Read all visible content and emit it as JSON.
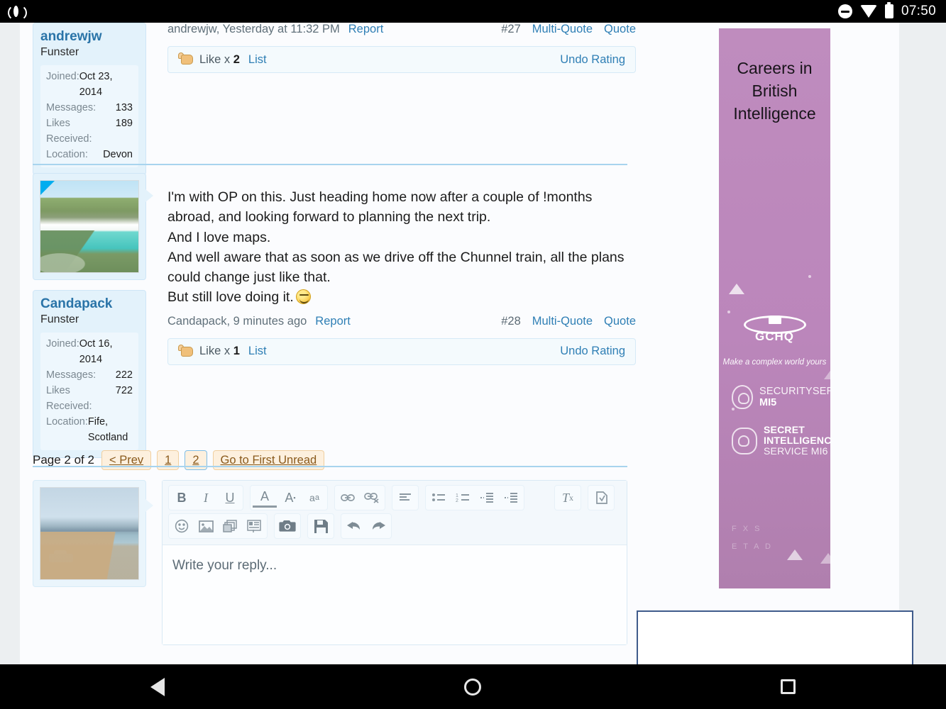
{
  "status_bar": {
    "time": "07:50",
    "icons": [
      "broadcast-icon",
      "do-not-disturb-icon",
      "wifi-icon",
      "battery-icon"
    ]
  },
  "posts": [
    {
      "user": {
        "name": "andrewjw",
        "title": "Funster",
        "stats": [
          {
            "key": "Joined:",
            "value": "Oct 23, 2014"
          },
          {
            "key": "Messages:",
            "value": "133"
          },
          {
            "key": "Likes Received:",
            "value": "189"
          },
          {
            "key": "Location:",
            "value": "Devon"
          }
        ]
      },
      "meta": {
        "byline": "andrewjw, Yesterday at 11:32 PM",
        "report": "Report",
        "number": "#27",
        "multi_quote": "Multi-Quote",
        "quote": "Quote"
      },
      "rating": {
        "label": "Like x",
        "count": "2",
        "list": "List",
        "undo": "Undo Rating"
      }
    },
    {
      "user": {
        "name": "Candapack",
        "title": "Funster",
        "stats": [
          {
            "key": "Joined:",
            "value": "Oct 16, 2014"
          },
          {
            "key": "Messages:",
            "value": "222"
          },
          {
            "key": "Likes Received:",
            "value": "722"
          },
          {
            "key": "Location:",
            "value": "Fife, Scotland"
          }
        ]
      },
      "body_lines": [
        "I'm with OP on this. Just heading home now after a couple of !months",
        "abroad, and looking forward to planning the next trip.",
        "And I love maps.",
        "And well aware that as soon as we drive off the Chunnel train, all the plans",
        "could change just like that.",
        "But still love doing it."
      ],
      "meta": {
        "byline": "Candapack, 9 minutes ago",
        "report": "Report",
        "number": "#28",
        "multi_quote": "Multi-Quote",
        "quote": "Quote"
      },
      "rating": {
        "label": "Like x",
        "count": "1",
        "list": "List",
        "undo": "Undo Rating"
      }
    }
  ],
  "pagination": {
    "label": "Page 2 of 2",
    "prev": "< Prev",
    "page1": "1",
    "page2": "2",
    "first_unread": "Go to First Unread"
  },
  "editor": {
    "placeholder": "Write your reply...",
    "toolbar_row1": [
      {
        "name": "bold-icon",
        "glyph": "B"
      },
      {
        "name": "italic-icon",
        "glyph": "I"
      },
      {
        "name": "underline-icon",
        "glyph": "U"
      },
      {
        "name": "text-color-icon",
        "glyph": "A"
      },
      {
        "name": "font-size-icon",
        "glyph": "A"
      },
      {
        "name": "font-family-icon",
        "glyph": "a"
      },
      {
        "name": "insert-link-icon",
        "glyph": "link"
      },
      {
        "name": "remove-link-icon",
        "glyph": "unlink"
      },
      {
        "name": "align-icon",
        "glyph": "align"
      },
      {
        "name": "bullet-list-icon",
        "glyph": "ul"
      },
      {
        "name": "numbered-list-icon",
        "glyph": "ol"
      },
      {
        "name": "indent-icon",
        "glyph": "indent"
      },
      {
        "name": "outdent-icon",
        "glyph": "outdent"
      },
      {
        "name": "remove-formatting-icon",
        "glyph": "Tx"
      },
      {
        "name": "draft-icon",
        "glyph": "draft"
      }
    ],
    "toolbar_row2": [
      {
        "name": "smilies-icon",
        "glyph": "smile"
      },
      {
        "name": "insert-image-icon",
        "glyph": "image"
      },
      {
        "name": "media-icon",
        "glyph": "media"
      },
      {
        "name": "insert-quote-icon",
        "glyph": "quote"
      },
      {
        "name": "camera-icon",
        "glyph": "camera"
      },
      {
        "name": "save-icon",
        "glyph": "save"
      },
      {
        "name": "undo-icon",
        "glyph": "undo"
      },
      {
        "name": "redo-icon",
        "glyph": "redo"
      }
    ]
  },
  "advertisement": {
    "headline_lines": [
      "Careers in",
      "British",
      "Intelligence"
    ],
    "gchq": "GCHQ",
    "tagline": "Make a complex world yours",
    "security_service": {
      "line1_bold": "SECURITY",
      "line1_light": "SERVICE",
      "line2": "MI5"
    },
    "secret_intelligence": {
      "line1": "SECRET",
      "line2": "INTELLIGENCE",
      "line3_bold": "SERVICE",
      "line3_light": "MI6"
    }
  },
  "colors": {
    "link": "#2f7fb5",
    "username": "#2a74a8",
    "usercard_bg": "#e3f2fb",
    "ad_bg": "#bb86bb",
    "pager_btn": "#fdf0de",
    "pager_border": "#f0cfa0"
  },
  "navigation_bar": {
    "back": "back-icon",
    "home": "home-icon",
    "recents": "recents-icon"
  }
}
